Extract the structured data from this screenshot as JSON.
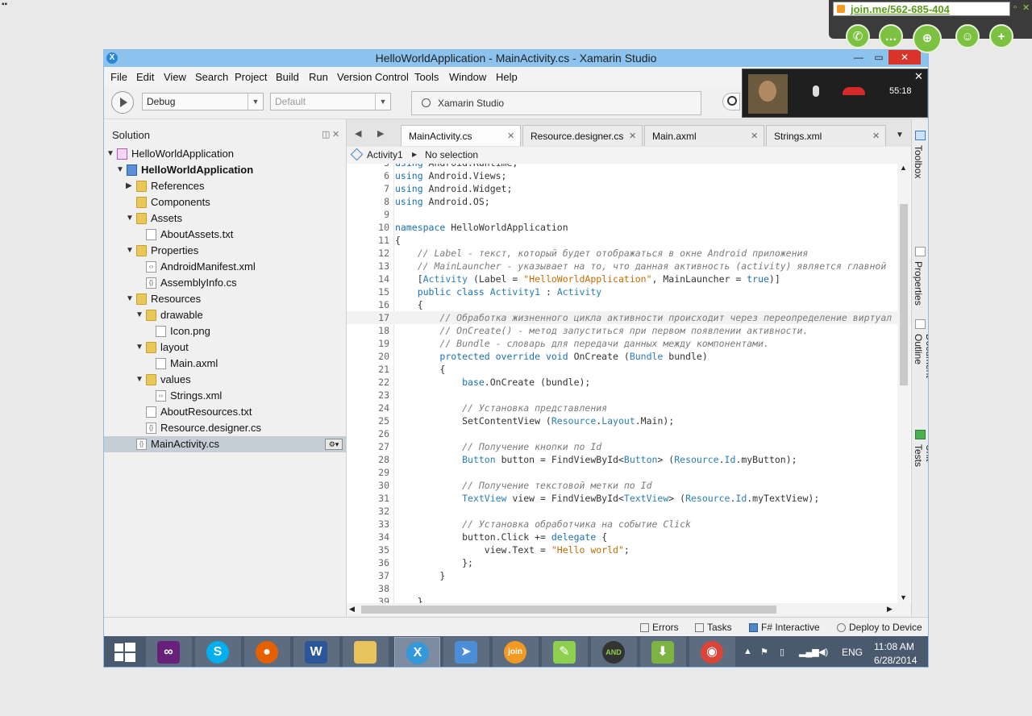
{
  "window": {
    "title": "HelloWorldApplication - MainActivity.cs - Xamarin Studio",
    "minimize": "—",
    "maximize": "▭",
    "close": "✕"
  },
  "menu": [
    "File",
    "Edit",
    "View",
    "Search",
    "Project",
    "Build",
    "Run",
    "Version Control",
    "Tools",
    "Window",
    "Help"
  ],
  "toolbar": {
    "configuration": "Debug",
    "platform": "Default",
    "status": "Xamarin Studio"
  },
  "solution": {
    "title": "Solution",
    "items": [
      {
        "label": "HelloWorldApplication",
        "depth": 0,
        "icon": "solution-icon",
        "arrow": "▼"
      },
      {
        "label": "HelloWorldApplication",
        "depth": 1,
        "icon": "project-icon",
        "arrow": "▼",
        "bold": true
      },
      {
        "label": "References",
        "depth": 2,
        "icon": "folder-icon",
        "arrow": "▶"
      },
      {
        "label": "Components",
        "depth": 2,
        "icon": "folder-icon",
        "arrow": ""
      },
      {
        "label": "Assets",
        "depth": 2,
        "icon": "folder-icon",
        "arrow": "▼"
      },
      {
        "label": "AboutAssets.txt",
        "depth": 3,
        "icon": "text-file-icon",
        "arrow": ""
      },
      {
        "label": "Properties",
        "depth": 2,
        "icon": "folder-icon",
        "arrow": "▼"
      },
      {
        "label": "AndroidManifest.xml",
        "depth": 3,
        "icon": "xml-file-icon",
        "arrow": ""
      },
      {
        "label": "AssemblyInfo.cs",
        "depth": 3,
        "icon": "cs-file-icon",
        "arrow": ""
      },
      {
        "label": "Resources",
        "depth": 2,
        "icon": "folder-icon",
        "arrow": "▼"
      },
      {
        "label": "drawable",
        "depth": 3,
        "icon": "folder-icon",
        "arrow": "▼"
      },
      {
        "label": "Icon.png",
        "depth": 4,
        "icon": "file-icon",
        "arrow": ""
      },
      {
        "label": "layout",
        "depth": 3,
        "icon": "folder-icon",
        "arrow": "▼"
      },
      {
        "label": "Main.axml",
        "depth": 4,
        "icon": "file-icon",
        "arrow": ""
      },
      {
        "label": "values",
        "depth": 3,
        "icon": "folder-icon",
        "arrow": "▼"
      },
      {
        "label": "Strings.xml",
        "depth": 4,
        "icon": "xml-file-icon",
        "arrow": ""
      },
      {
        "label": "AboutResources.txt",
        "depth": 3,
        "icon": "text-file-icon",
        "arrow": ""
      },
      {
        "label": "Resource.designer.cs",
        "depth": 3,
        "icon": "cs-file-icon",
        "arrow": ""
      },
      {
        "label": "MainActivity.cs",
        "depth": 2,
        "icon": "cs-file-icon",
        "arrow": "",
        "selected": true
      }
    ]
  },
  "tabs": [
    {
      "label": "MainActivity.cs",
      "active": true
    },
    {
      "label": "Resource.designer.cs",
      "active": false
    },
    {
      "label": "Main.axml",
      "active": false
    },
    {
      "label": "Strings.xml",
      "active": false
    }
  ],
  "pathbar": {
    "class": "Activity1",
    "member": "No selection"
  },
  "code": {
    "current_line": 17,
    "lines": [
      {
        "n": "5",
        "tokens": [
          [
            "kw",
            "using"
          ],
          [
            "nm",
            " Android.Runtime;"
          ]
        ]
      },
      {
        "n": "6",
        "tokens": [
          [
            "kw",
            "using"
          ],
          [
            "nm",
            " Android.Views;"
          ]
        ]
      },
      {
        "n": "7",
        "tokens": [
          [
            "kw",
            "using"
          ],
          [
            "nm",
            " Android.Widget;"
          ]
        ]
      },
      {
        "n": "8",
        "tokens": [
          [
            "kw",
            "using"
          ],
          [
            "nm",
            " Android.OS;"
          ]
        ]
      },
      {
        "n": "9",
        "tokens": []
      },
      {
        "n": "10",
        "tokens": [
          [
            "kw",
            "namespace"
          ],
          [
            "nm",
            " HelloWorldApplication"
          ]
        ]
      },
      {
        "n": "11",
        "tokens": [
          [
            "nm",
            "{"
          ]
        ]
      },
      {
        "n": "12",
        "tokens": [
          [
            "nm",
            "    "
          ],
          [
            "cm",
            "// Label - текст, который будет отображаться в окне Android приложения"
          ]
        ]
      },
      {
        "n": "13",
        "tokens": [
          [
            "nm",
            "    "
          ],
          [
            "cm",
            "// MainLauncher - указывает на то, что данная активность (activity) является главной"
          ]
        ]
      },
      {
        "n": "14",
        "tokens": [
          [
            "nm",
            "    ["
          ],
          [
            "ty",
            "Activity"
          ],
          [
            "nm",
            " (Label = "
          ],
          [
            "str",
            "\"HelloWorldApplication\""
          ],
          [
            "nm",
            ", MainLauncher = "
          ],
          [
            "kw",
            "true"
          ],
          [
            "nm",
            ")]"
          ]
        ]
      },
      {
        "n": "15",
        "tokens": [
          [
            "nm",
            "    "
          ],
          [
            "kw",
            "public class"
          ],
          [
            "nm",
            " "
          ],
          [
            "ty",
            "Activity1"
          ],
          [
            "nm",
            " : "
          ],
          [
            "ty",
            "Activity"
          ]
        ]
      },
      {
        "n": "16",
        "tokens": [
          [
            "nm",
            "    {"
          ]
        ]
      },
      {
        "n": "17",
        "tokens": [
          [
            "nm",
            "        "
          ],
          [
            "cm",
            "// Обработка жизненного цикла активности происходит через переопределение виртуал"
          ]
        ]
      },
      {
        "n": "18",
        "tokens": [
          [
            "nm",
            "        "
          ],
          [
            "cm",
            "// OnCreate() - метод запуститься при первом появлении активности."
          ]
        ]
      },
      {
        "n": "19",
        "tokens": [
          [
            "nm",
            "        "
          ],
          [
            "cm",
            "// Bundle - словарь для передачи данных между компонентами."
          ]
        ]
      },
      {
        "n": "20",
        "tokens": [
          [
            "nm",
            "        "
          ],
          [
            "kw",
            "protected override void"
          ],
          [
            "nm",
            " OnCreate ("
          ],
          [
            "ty",
            "Bundle"
          ],
          [
            "nm",
            " bundle)"
          ]
        ]
      },
      {
        "n": "21",
        "tokens": [
          [
            "nm",
            "        {"
          ]
        ]
      },
      {
        "n": "22",
        "tokens": [
          [
            "nm",
            "            "
          ],
          [
            "kw",
            "base"
          ],
          [
            "nm",
            ".OnCreate (bundle);"
          ]
        ]
      },
      {
        "n": "23",
        "tokens": []
      },
      {
        "n": "24",
        "tokens": [
          [
            "nm",
            "            "
          ],
          [
            "cm",
            "// Установка представления"
          ]
        ]
      },
      {
        "n": "25",
        "tokens": [
          [
            "nm",
            "            SetContentView ("
          ],
          [
            "ty",
            "Resource"
          ],
          [
            "nm",
            "."
          ],
          [
            "ty",
            "Layout"
          ],
          [
            "nm",
            ".Main);"
          ]
        ]
      },
      {
        "n": "26",
        "tokens": []
      },
      {
        "n": "27",
        "tokens": [
          [
            "nm",
            "            "
          ],
          [
            "cm",
            "// Получение кнопки по Id"
          ]
        ]
      },
      {
        "n": "28",
        "tokens": [
          [
            "nm",
            "            "
          ],
          [
            "ty",
            "Button"
          ],
          [
            "nm",
            " button = FindViewById<"
          ],
          [
            "ty",
            "Button"
          ],
          [
            "nm",
            "> ("
          ],
          [
            "ty",
            "Resource"
          ],
          [
            "nm",
            "."
          ],
          [
            "ty",
            "Id"
          ],
          [
            "nm",
            ".myButton);"
          ]
        ]
      },
      {
        "n": "29",
        "tokens": []
      },
      {
        "n": "30",
        "tokens": [
          [
            "nm",
            "            "
          ],
          [
            "cm",
            "// Получение текстовой метки по Id"
          ]
        ]
      },
      {
        "n": "31",
        "tokens": [
          [
            "nm",
            "            "
          ],
          [
            "ty",
            "TextView"
          ],
          [
            "nm",
            " view = FindViewById<"
          ],
          [
            "ty",
            "TextView"
          ],
          [
            "nm",
            "> ("
          ],
          [
            "ty",
            "Resource"
          ],
          [
            "nm",
            "."
          ],
          [
            "ty",
            "Id"
          ],
          [
            "nm",
            ".myTextView);"
          ]
        ]
      },
      {
        "n": "32",
        "tokens": []
      },
      {
        "n": "33",
        "tokens": [
          [
            "nm",
            "            "
          ],
          [
            "cm",
            "// Установка обработчика на событие Click"
          ]
        ]
      },
      {
        "n": "34",
        "tokens": [
          [
            "nm",
            "            button.Click += "
          ],
          [
            "kw",
            "delegate"
          ],
          [
            "nm",
            " {"
          ]
        ]
      },
      {
        "n": "35",
        "tokens": [
          [
            "nm",
            "                view.Text = "
          ],
          [
            "str",
            "\"Hello world\""
          ],
          [
            "nm",
            ";"
          ]
        ]
      },
      {
        "n": "36",
        "tokens": [
          [
            "nm",
            "            };"
          ]
        ]
      },
      {
        "n": "37",
        "tokens": [
          [
            "nm",
            "        }"
          ]
        ]
      },
      {
        "n": "38",
        "tokens": []
      },
      {
        "n": "39",
        "tokens": [
          [
            "nm",
            "    }"
          ]
        ]
      }
    ]
  },
  "dock": [
    "Toolbox",
    "Properties",
    "Document Outline",
    "Unit Tests"
  ],
  "statusbar": {
    "errors": "Errors",
    "tasks": "Tasks",
    "interactive": "F# Interactive",
    "deploy": "Deploy to Device"
  },
  "taskbar": {
    "apps": [
      "Visual Studio",
      "Skype",
      "Firefox",
      "Word",
      "File Explorer",
      "Xamarin Studio",
      "Xamarin Mail",
      "join.me",
      "Notepad",
      "Android",
      "Download",
      "Chrome"
    ],
    "language": "ENG",
    "time": "11:08 AM",
    "date": "6/28/2014"
  },
  "joinme": {
    "url": "join.me/562-685-404",
    "call_timer": "55:18"
  }
}
